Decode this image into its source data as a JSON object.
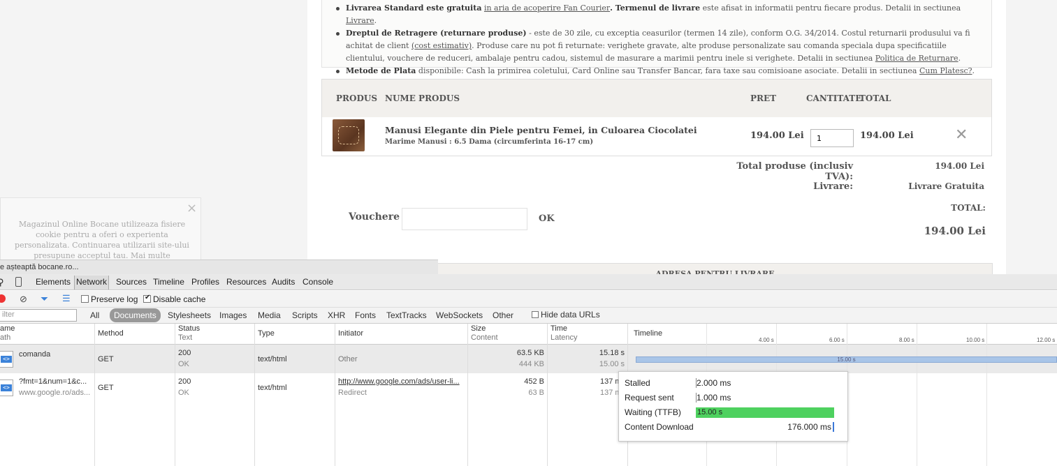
{
  "shop": {
    "info": {
      "line1_bold": "Livrarea Standard este gratuita",
      "line1_link": "in aria de acoperire Fan Courier",
      "line1_rest": ". Termenul de livrare",
      "line1_tail": "este afisat in informatii pentru fiecare produs. Detalii in sectiunea",
      "line1_link2": "Livrare",
      "line2_bold": "Dreptul de Retragere (returnare produse)",
      "line2_text": "- este de 30 zile, cu exceptia ceasurilor (termen 14 zile), conform O.G. 34/2014. Costul returnarii produsului va fi achitat de client",
      "line2_link": "(cost estimativ)",
      "line2_cont": "Produse care nu pot fi returnate: verighete gravate, alte produse personalizate sau comanda speciala dupa specificatiile clientului, vouchere de reduceri, ambalaje pentru cadou, sistemul de masurare a marimii pentru inele si verighete. Detalii in sectiunea",
      "line2_link2": "Politica de Returnare",
      "line3_bold": "Metode de Plata",
      "line3_text": "disponibile: Cash la primirea coletului, Card Online sau Transfer Bancar, fara taxe sau comisioane asociate. Detalii in sectiunea",
      "line3_link": "Cum Platesc?"
    },
    "cart_header": {
      "produs": "PRODUS",
      "nume": "NUME PRODUS",
      "pret": "PRET",
      "cantitate": "CANTITATE",
      "total": "TOTAL"
    },
    "item": {
      "name": "Manusi Elegante din Piele pentru Femei, in Culoarea Ciocolatei",
      "size": "Marime Manusi : 6.5 Dama (circumferinta 16-17 cm)",
      "price": "194.00 Lei",
      "quantity": "1",
      "total": "194.00 Lei"
    },
    "summary": {
      "total_label": "Total produse (inclusiv TVA):",
      "total_value": "194.00 Lei",
      "delivery_label": "Livrare:",
      "delivery_value": "Livrare Gratuita",
      "grand_label": "TOTAL:",
      "grand_value": "194.00 Lei"
    },
    "voucher": {
      "label": "Vouchere",
      "ok": "OK"
    },
    "address_header": "ADRESA PENTRU LIVRARE",
    "cookie": {
      "text": "Magazinul Online Bocane utilizeaza fisiere cookie pentru a oferi o experienta personalizata. Continuarea utilizarii site-ului presupune acceptul tau. Mai multe informatii >>",
      "close": "×"
    },
    "status": "e așteaptă bocane.ro..."
  },
  "devtools": {
    "tabs": [
      "Elements",
      "Network",
      "Sources",
      "Timeline",
      "Profiles",
      "Resources",
      "Audits",
      "Console"
    ],
    "active_tab": "Network",
    "toolbar": {
      "preserve_log": "Preserve log",
      "disable_cache": "Disable cache",
      "preserve_checked": false,
      "disable_checked": true
    },
    "filter": {
      "placeholder": "ilter",
      "types": [
        "All",
        "Documents",
        "Stylesheets",
        "Images",
        "Media",
        "Scripts",
        "XHR",
        "Fonts",
        "TextTracks",
        "WebSockets",
        "Other"
      ],
      "active_type": "Documents",
      "hide_data_urls": "Hide data URLs"
    },
    "columns": {
      "name": "ame",
      "name_sub": "ath",
      "method": "Method",
      "status": "Status",
      "status_sub": "Text",
      "type": "Type",
      "initiator": "Initiator",
      "size": "Size",
      "size_sub": "Content",
      "time": "Time",
      "time_sub": "Latency",
      "timeline": "Timeline"
    },
    "timeline_ticks": [
      "4.00 s",
      "6.00 s",
      "8.00 s",
      "10.00 s",
      "12.00 s"
    ],
    "requests": [
      {
        "name": "comanda",
        "path": "",
        "method": "GET",
        "status": "200",
        "status_text": "OK",
        "type": "text/html",
        "initiator": "Other",
        "initiator_sub": "",
        "size": "63.5 KB",
        "content": "444 KB",
        "time": "15.18 s",
        "latency": "15.00 s",
        "bar_label": "15.00 s"
      },
      {
        "name": "?fmt=1&num=1&c...",
        "path": "www.google.ro/ads...",
        "method": "GET",
        "status": "200",
        "status_text": "OK",
        "type": "text/html",
        "initiator": "http://www.google.com/ads/user-li...",
        "initiator_sub": "Redirect",
        "size": "452 B",
        "content": "63 B",
        "time": "137 ms",
        "latency": "137 ms"
      }
    ],
    "tooltip": {
      "stalled_label": "Stalled",
      "stalled": "2.000 ms",
      "sent_label": "Request sent",
      "sent": "1.000 ms",
      "waiting_label": "Waiting (TTFB)",
      "waiting": "15.00 s",
      "download_label": "Content Download",
      "download": "176.000 ms"
    },
    "colors": {
      "waiting_bar": "#4ed15f",
      "timeline_bar": "#a9c5e8",
      "accent": "#3b82d9"
    }
  }
}
